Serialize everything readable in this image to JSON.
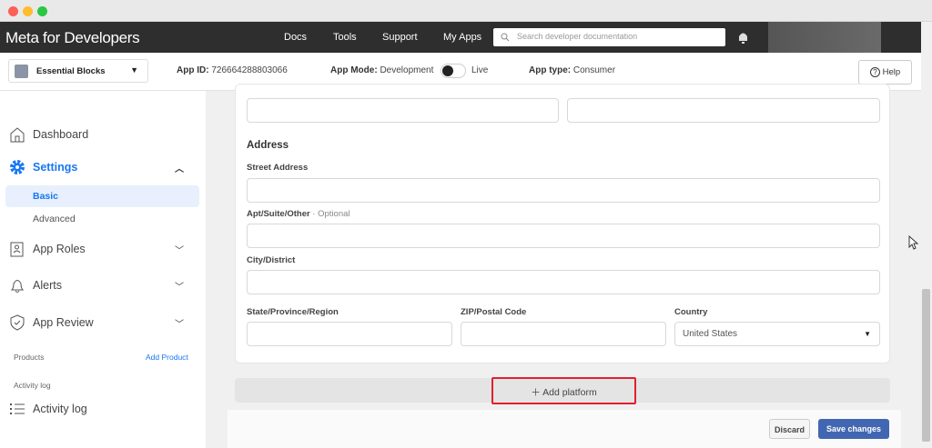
{
  "window": {
    "controls": [
      "close",
      "minimize",
      "maximize"
    ]
  },
  "nav": {
    "logo": "Meta for Developers",
    "links": [
      "Docs",
      "Tools",
      "Support",
      "My Apps"
    ],
    "search_placeholder": "Search developer documentation"
  },
  "appbar": {
    "app_name": "Essential Blocks",
    "app_id_label": "App ID:",
    "app_id": "726664288803066",
    "mode_label": "App Mode:",
    "mode_dev": "Development",
    "mode_live": "Live",
    "type_label": "App type:",
    "type_value": "Consumer",
    "help": "Help"
  },
  "sidebar": {
    "dashboard": "Dashboard",
    "settings": "Settings",
    "basic": "Basic",
    "advanced": "Advanced",
    "app_roles": "App Roles",
    "alerts": "Alerts",
    "app_review": "App Review",
    "products": "Products",
    "add_product": "Add Product",
    "activity_section": "Activity log",
    "activity_log": "Activity log"
  },
  "form": {
    "address_heading": "Address",
    "street": "Street Address",
    "apt": "Apt/Suite/Other",
    "optional": " · Optional",
    "city": "City/District",
    "state": "State/Province/Region",
    "zip": "ZIP/Postal Code",
    "country": "Country",
    "country_value": "United States"
  },
  "add_platform": "Add platform",
  "footer": {
    "discard": "Discard",
    "save": "Save changes"
  },
  "colors": {
    "accent": "#1877f2",
    "save": "#4267b2",
    "highlight": "#e0202f"
  }
}
